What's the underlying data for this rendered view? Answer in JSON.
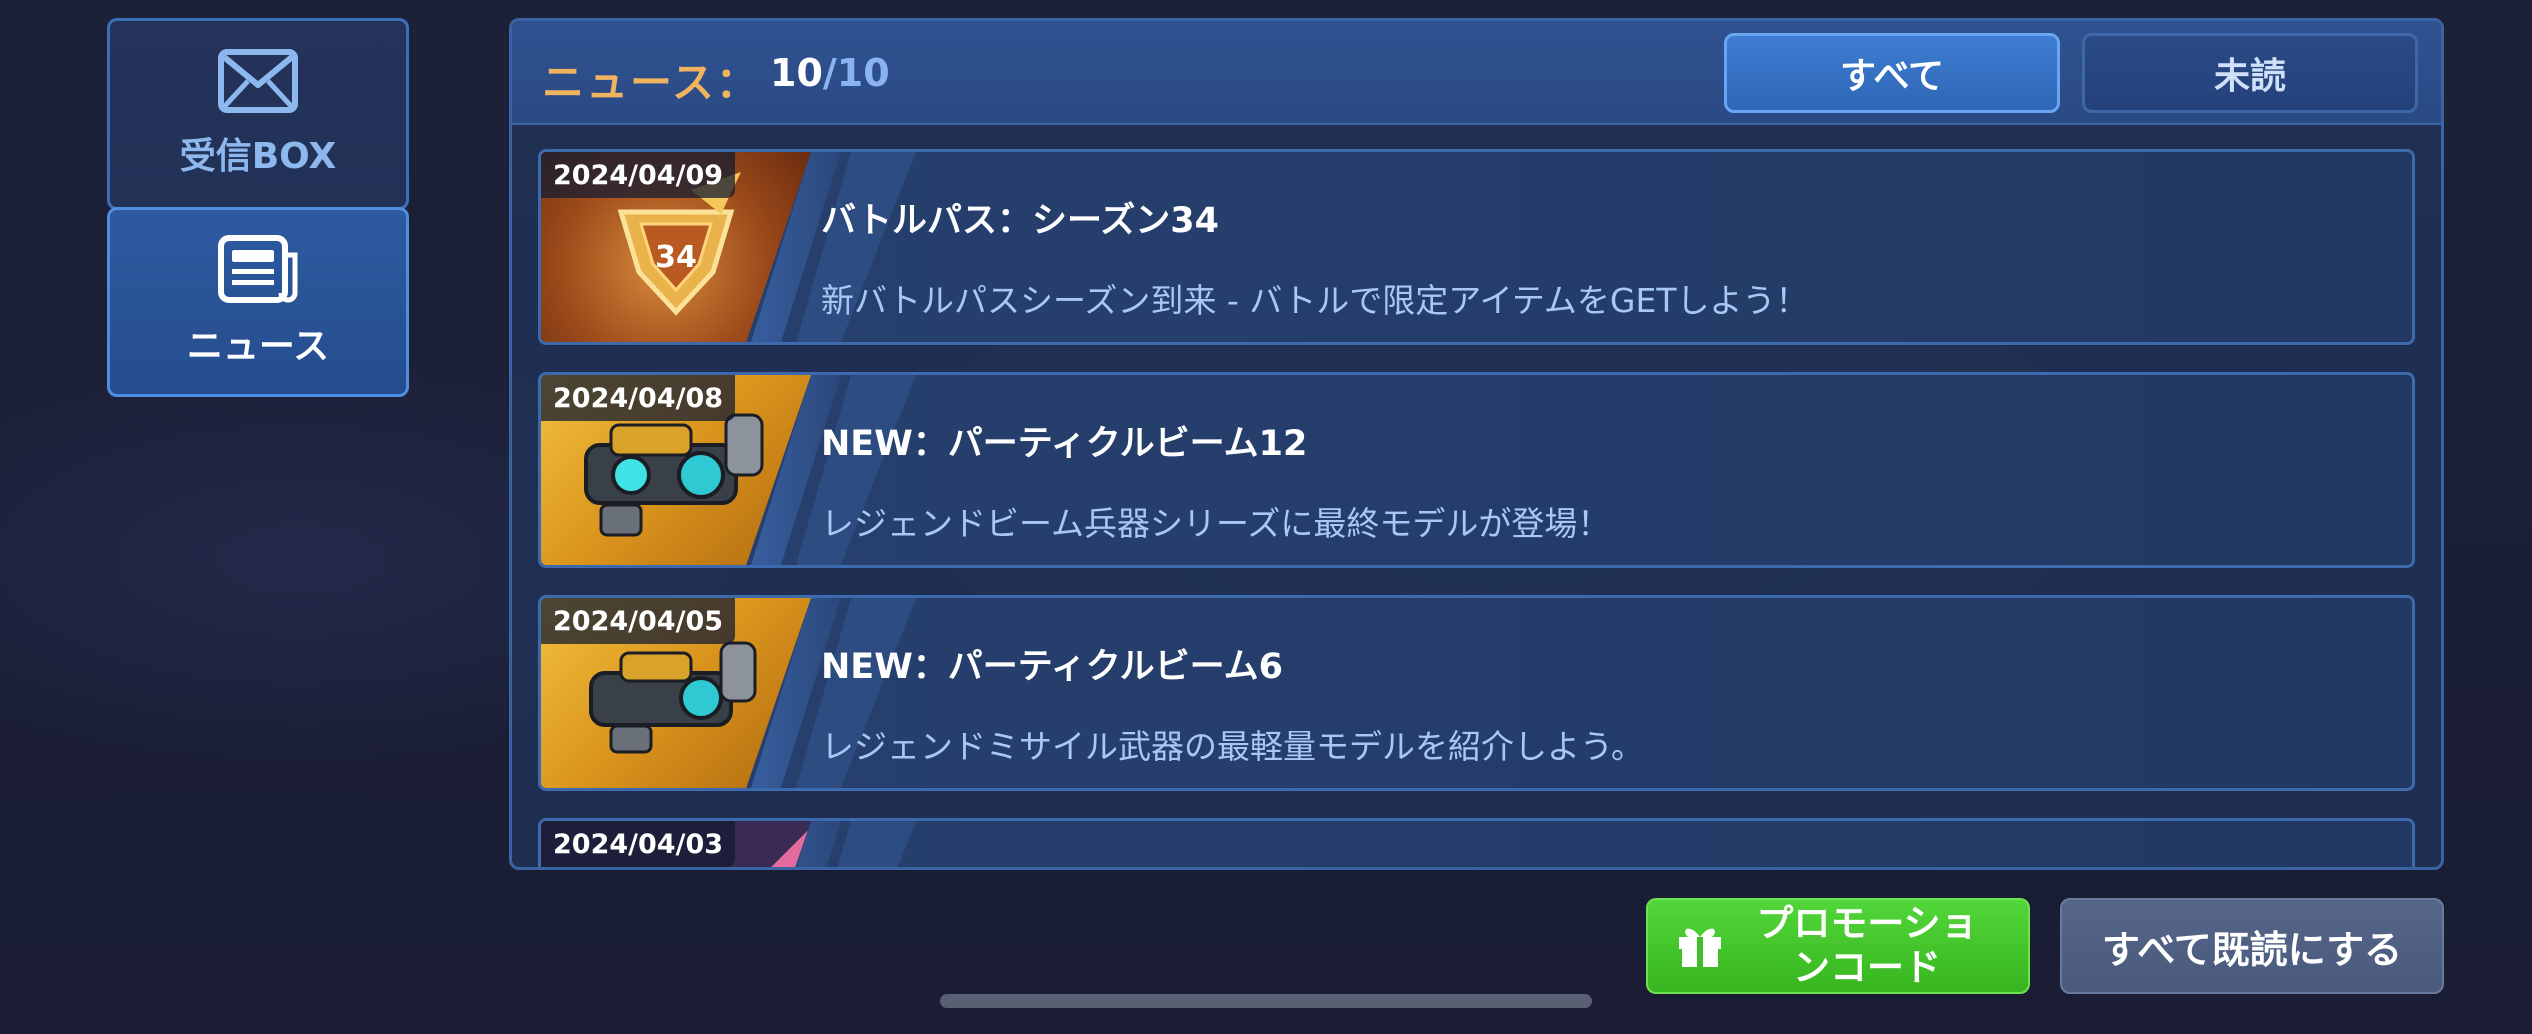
{
  "sidebar": {
    "tabs": [
      {
        "label": "受信BOX",
        "icon": "envelope-icon",
        "selected": false
      },
      {
        "label": "ニュース",
        "icon": "newspaper-icon",
        "selected": true
      }
    ]
  },
  "header": {
    "title": "ニュース：",
    "count_current": "10",
    "count_separator": "/",
    "count_total": "10",
    "filters": [
      {
        "label": "すべて",
        "selected": true
      },
      {
        "label": "未読",
        "selected": false
      }
    ]
  },
  "news": [
    {
      "date": "2024/04/09",
      "title": "バトルパス：シーズン34",
      "description": "新バトルパスシーズン到来 - バトルで限定アイテムをGETしよう！",
      "thumb_badge": "34",
      "thumb_icon": "battle-pass-badge-icon"
    },
    {
      "date": "2024/04/08",
      "title": "NEW：パーティクルビーム12",
      "description": "レジェンドビーム兵器シリーズに最終モデルが登場！",
      "thumb_icon": "particle-beam-weapon-icon"
    },
    {
      "date": "2024/04/05",
      "title": "NEW：パーティクルビーム6",
      "description": "レジェンドミサイル武器の最軽量モデルを紹介しよう。",
      "thumb_icon": "particle-beam-weapon-icon"
    },
    {
      "date": "2024/04/03",
      "title": "",
      "description": "",
      "thumb_icon": "news-thumbnail-icon"
    }
  ],
  "footer": {
    "promo_label_line1": "プロモーショ",
    "promo_label_line2": "ンコード",
    "promo_icon": "gift-icon",
    "read_all_label": "すべて既読にする"
  },
  "colors": {
    "accent_blue": "#3e7dd2",
    "title_orange": "#f0b35e",
    "promo_green": "#52d63a"
  }
}
